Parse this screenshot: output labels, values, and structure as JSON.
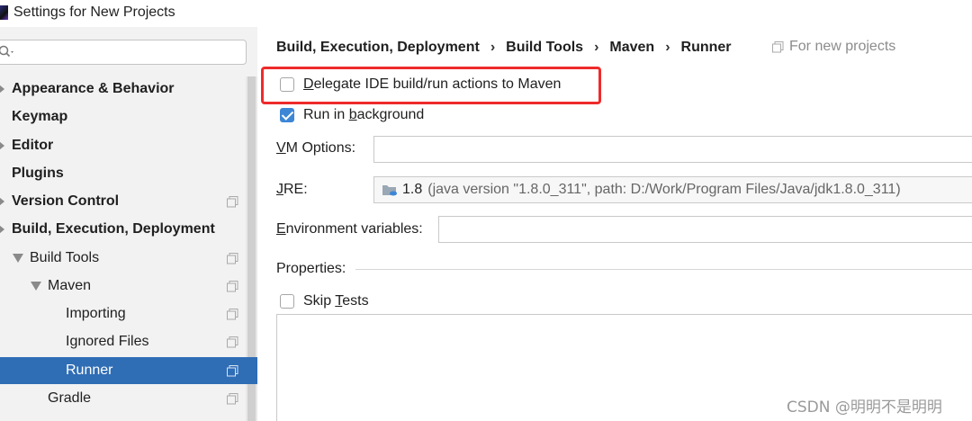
{
  "window": {
    "title": "Settings for New Projects"
  },
  "sidebar": {
    "search": {
      "value": "",
      "placeholder": ""
    },
    "items": [
      {
        "label": "Appearance & Behavior"
      },
      {
        "label": "Keymap"
      },
      {
        "label": "Editor"
      },
      {
        "label": "Plugins"
      },
      {
        "label": "Version Control"
      },
      {
        "label": "Build, Execution, Deployment"
      },
      {
        "label": "Build Tools"
      },
      {
        "label": "Maven"
      },
      {
        "label": "Importing"
      },
      {
        "label": "Ignored Files"
      },
      {
        "label": "Runner"
      },
      {
        "label": "Gradle"
      }
    ],
    "selected": "Runner"
  },
  "breadcrumb": {
    "items": [
      "Build, Execution, Deployment",
      "Build Tools",
      "Maven",
      "Runner"
    ],
    "separator": "›",
    "scope_label": "For new projects"
  },
  "form": {
    "delegate": {
      "pre": "",
      "u": "D",
      "post": "elegate IDE build/run actions to Maven",
      "checked": false
    },
    "background": {
      "pre": "Run in ",
      "u": "b",
      "post": "ackground",
      "checked": true
    },
    "vm_options": {
      "u": "V",
      "post": "M Options:",
      "value": ""
    },
    "jre": {
      "u": "J",
      "post": "RE:",
      "version": "1.8",
      "detail": "(java version \"1.8.0_311\", path: D:/Work/Program Files/Java/jdk1.8.0_311)"
    },
    "env": {
      "u": "E",
      "post": "nvironment variables:",
      "value": ""
    },
    "properties": {
      "label": "Properties:"
    },
    "skip_tests": {
      "pre": "Skip ",
      "u": "T",
      "post": "ests",
      "checked": false
    }
  },
  "watermark": "CSDN @明明不是明明",
  "colors": {
    "selection": "#2f6db5",
    "highlight": "#ef2b2b",
    "checkbox_checked": "#3d86d6"
  }
}
